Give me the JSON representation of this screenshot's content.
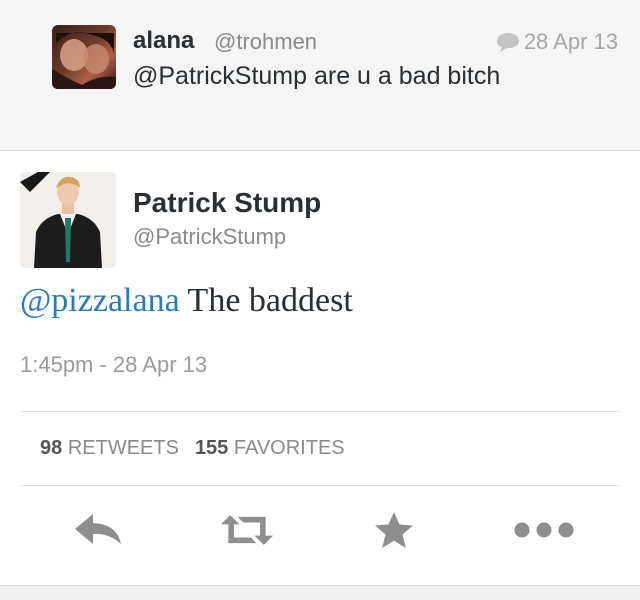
{
  "reply": {
    "name": "alana",
    "handle": "@trohmen",
    "date": "28 Apr 13",
    "text": "@PatrickStump are u a bad bitch"
  },
  "tweet": {
    "name": "Patrick Stump",
    "handle": "@PatrickStump",
    "mention": "@pizzalana",
    "text": " The baddest",
    "timestamp": "1:45pm - 28 Apr 13",
    "retweets_count": "98",
    "retweets_label": "RETWEETS",
    "favorites_count": "155",
    "favorites_label": "FAVORITES"
  },
  "actions": [
    {
      "icon": "reply-icon"
    },
    {
      "icon": "retweet-icon"
    },
    {
      "icon": "favorite-star-icon"
    },
    {
      "icon": "more-dots-icon"
    }
  ],
  "colors": {
    "link": "#2b7bb9",
    "text": "#292f33",
    "muted": "#8a8a8a",
    "icon": "#8e8e8e"
  }
}
